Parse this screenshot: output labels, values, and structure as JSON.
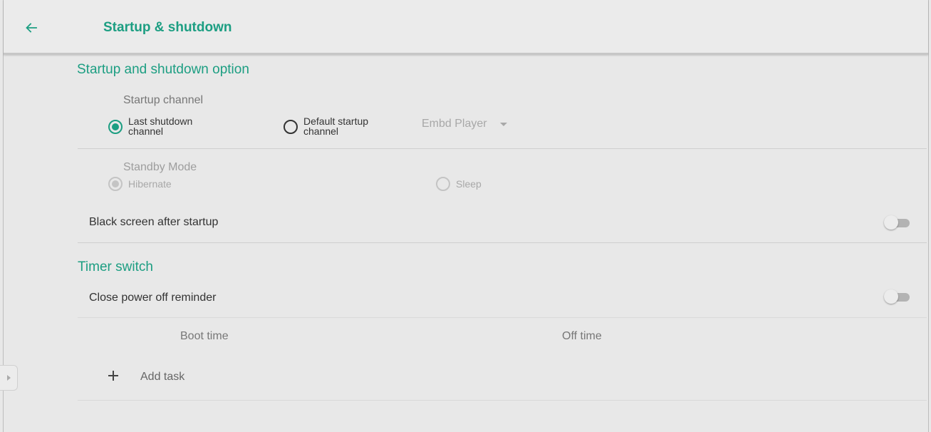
{
  "header": {
    "title": "Startup & shutdown"
  },
  "startup_section": {
    "title": "Startup and shutdown option",
    "startup_channel": {
      "label": "Startup channel",
      "options": [
        {
          "line1": "Last shutdown",
          "line2": "channel",
          "selected": true
        },
        {
          "line1": "Default startup",
          "line2": "channel",
          "selected": false
        }
      ],
      "default_source_value": "Embd Player"
    },
    "standby_mode": {
      "label": "Standby Mode",
      "options": [
        {
          "label": "Hibernate",
          "selected": true
        },
        {
          "label": "Sleep",
          "selected": false
        }
      ]
    },
    "black_screen": {
      "label": "Black screen after startup",
      "enabled": false
    }
  },
  "timer_section": {
    "title": "Timer switch",
    "power_off_reminder": {
      "label": "Close power off reminder",
      "enabled": false
    },
    "columns": [
      "Boot time",
      "Off time"
    ],
    "add_task_label": "Add task"
  },
  "colors": {
    "accent": "#1c9e82",
    "background": "#e8e8e8"
  }
}
